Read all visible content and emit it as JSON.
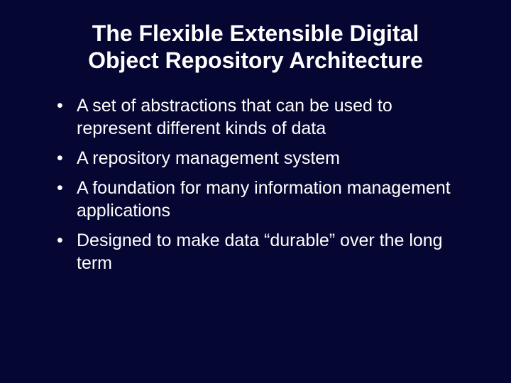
{
  "title": "The Flexible Extensible Digital Object Repository Architecture",
  "bullets": [
    "A set of abstractions that can be used to represent different kinds of data",
    "A repository management system",
    "A foundation for many information management applications",
    "Designed to make data “durable” over the long term"
  ]
}
